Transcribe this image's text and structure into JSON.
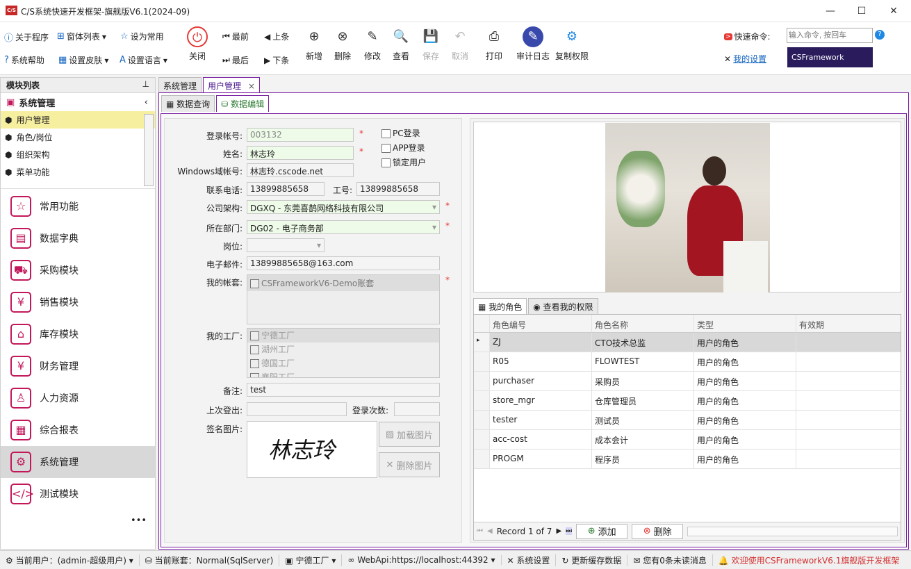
{
  "window": {
    "title": "C/S系统快速开发框架-旗舰版V6.1(2024-09)",
    "logo": "C/S"
  },
  "toolbar": {
    "row1": [
      "关于程序",
      "窗体列表",
      "设为常用"
    ],
    "row2": [
      "系统帮助",
      "设置皮肤",
      "设置语言"
    ],
    "close": "关闭",
    "nav": [
      "最前",
      "上条",
      "最后",
      "下条"
    ],
    "actions": [
      "新增",
      "删除",
      "修改",
      "查看",
      "保存",
      "取消",
      "打印",
      "审计日志",
      "复制权限"
    ],
    "quick_label": "快速命令:",
    "quick_placeholder": "输入命令, 按回车",
    "my_settings": "我的设置",
    "banner": "CSFramework"
  },
  "left": {
    "header": "模块列表",
    "group": "系统管理",
    "tree": [
      "用户管理",
      "角色/岗位",
      "组织架构",
      "菜单功能"
    ],
    "nav": [
      "常用功能",
      "数据字典",
      "采购模块",
      "销售模块",
      "库存模块",
      "财务管理",
      "人力资源",
      "综合报表",
      "系统管理",
      "测试模块"
    ],
    "more": "•••"
  },
  "tabs": [
    "系统管理",
    "用户管理"
  ],
  "subtabs": [
    "数据查询",
    "数据编辑"
  ],
  "form": {
    "account_label": "登录帐号:",
    "account": "003132",
    "name_label": "姓名:",
    "name": "林志玲",
    "domain_label": "Windows域帐号:",
    "domain": "林志玲.cscode.net",
    "phone_label": "联系电话:",
    "phone": "13899885658",
    "empno_label": "工号:",
    "empno": "13899885658",
    "company_label": "公司架构:",
    "company": "DGXQ - 东莞喜鹊网络科技有限公司",
    "dept_label": "所在部门:",
    "dept": "DG02 - 电子商务部",
    "post_label": "岗位:",
    "email_label": "电子邮件:",
    "email": "13899885658@163.com",
    "accounts_label": "我的帐套:",
    "accounts": [
      "CSFrameworkV6-Demo账套"
    ],
    "factory_label": "我的工厂:",
    "factories": [
      "宁德工厂",
      "湖州工厂",
      "德国工厂",
      "襄阳工厂"
    ],
    "remark_label": "备注:",
    "remark": "test",
    "lastlogout_label": "上次登出:",
    "logincount_label": "登录次数:",
    "sign_label": "签名图片:",
    "signature": "林志玲",
    "load_img": "加载图片",
    "del_img": "删除图片",
    "pc_login": "PC登录",
    "app_login": "APP登录",
    "lock_user": "锁定用户"
  },
  "roles": {
    "tabs": [
      "我的角色",
      "查看我的权限"
    ],
    "headers": [
      "角色编号",
      "角色名称",
      "类型",
      "有效期"
    ],
    "rows": [
      [
        "ZJ",
        "CTO技术总监",
        "用户的角色",
        ""
      ],
      [
        "R05",
        "FLOWTEST",
        "用户的角色",
        ""
      ],
      [
        "purchaser",
        "采购员",
        "用户的角色",
        ""
      ],
      [
        "store_mgr",
        "仓库管理员",
        "用户的角色",
        ""
      ],
      [
        "tester",
        "测试员",
        "用户的角色",
        ""
      ],
      [
        "acc-cost",
        "成本会计",
        "用户的角色",
        ""
      ],
      [
        "PROGM",
        "程序员",
        "用户的角色",
        ""
      ]
    ],
    "record": "Record 1 of 7",
    "add": "添加",
    "del": "删除"
  },
  "status": [
    "当前用户：(admin-超级用户)",
    "当前账套：Normal(SqlServer)",
    "宁德工厂",
    "WebApi:https://localhost:44392",
    "系统设置",
    "更新缓存数据",
    "您有0条未读消息",
    "欢迎使用CSFrameworkV6.1旗舰版开发框架"
  ]
}
